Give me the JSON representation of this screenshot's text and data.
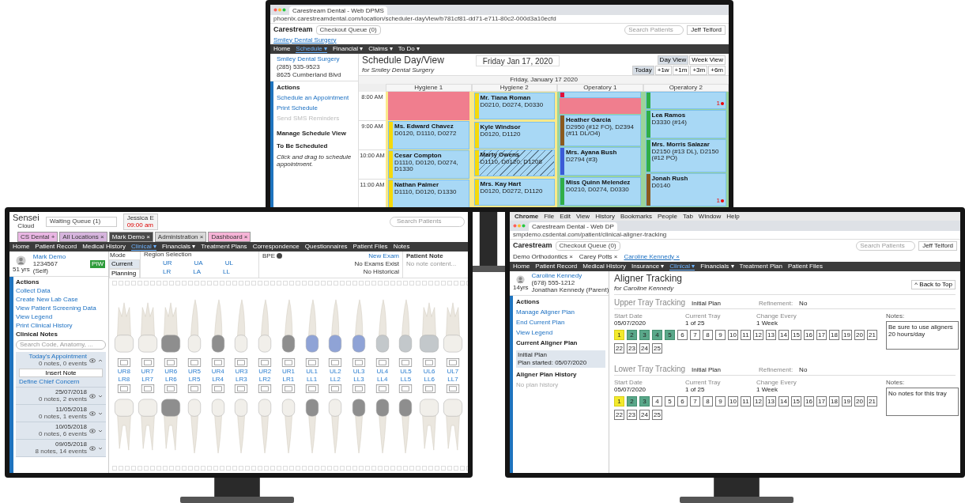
{
  "schedule_monitor": {
    "browser": {
      "tab_title": "Carestream Dental - Web DPMS",
      "url": "phoenix.carestreamdental.com/location/scheduler-dayView/b781cf81-dd71-e711-80c2-000d3a10ecfd"
    },
    "header": {
      "logo": "Carestream",
      "queue": "Checkout Queue (0)",
      "search_placeholder": "Search Patients",
      "user": "Jeff Telford"
    },
    "location_tab": "Smiley Dental Surgery",
    "nav": [
      {
        "label": "Home",
        "selected": false
      },
      {
        "label": "Schedule ▾",
        "selected": true
      },
      {
        "label": "Financial ▾",
        "selected": false
      },
      {
        "label": "Claims ▾",
        "selected": false
      },
      {
        "label": "To Do ▾",
        "selected": false
      }
    ],
    "sidebar": {
      "practice": "Smiley Dental Surgery",
      "phone": "(285) 535-9523",
      "address": "8625 Cumberland Blvd",
      "actions_title": "Actions",
      "actions": [
        {
          "label": "Schedule an Appointment",
          "disabled": false
        },
        {
          "label": "Print Schedule",
          "disabled": false
        },
        {
          "label": "Send SMS Reminders",
          "disabled": true
        }
      ],
      "manage": "Manage Schedule View",
      "to_schedule": "To Be Scheduled",
      "hint": "Click and drag to schedule appointment."
    },
    "title": "Schedule Day/View",
    "subtitle": "for Smiley Dental Surgery",
    "date": "Friday Jan 17, 2020",
    "views": [
      {
        "label": "Day View",
        "selected": true
      },
      {
        "label": "Week View",
        "selected": false
      }
    ],
    "jumps": [
      {
        "label": "Today",
        "selected": true
      },
      {
        "label": "+1w",
        "selected": false
      },
      {
        "label": "+1m",
        "selected": false
      },
      {
        "label": "+3m",
        "selected": false
      },
      {
        "label": "+6m",
        "selected": false
      }
    ],
    "day_header": "Friday, January 17 2020",
    "times": [
      "8:00 AM",
      "9:00 AM",
      "10:00 AM",
      "11:00 AM"
    ],
    "columns": [
      {
        "name": "Hygiene 1",
        "color": "#fbe98a",
        "items": [
          {
            "kind": "blocked"
          },
          {
            "kind": "appointment",
            "name": "Ms. Edward Chavez",
            "codes": "D0120, D1110, D0272",
            "color": "#f5d90a",
            "hatched": false
          },
          {
            "kind": "appointment",
            "name": "Cesar Compton",
            "codes": "D1110, D0120, D0274, D1330",
            "color": "#f5d90a",
            "hatched": false
          },
          {
            "kind": "appointment",
            "name": "Nathan Palmer",
            "codes": "D1110, D0120, D1330",
            "color": "#f5d90a",
            "hatched": false
          }
        ]
      },
      {
        "name": "Hygiene 2",
        "color": "#fbe98a",
        "items": [
          {
            "kind": "appointment",
            "name": "Mr. Tiana Roman",
            "codes": "D0210, D0274, D0330",
            "color": "#f5d90a",
            "hatched": false
          },
          {
            "kind": "appointment",
            "name": "Kyle Windsor",
            "codes": "D0120, D1120",
            "color": "#f5d90a",
            "hatched": false
          },
          {
            "kind": "appointment",
            "name": "Marty Owens",
            "codes": "D1110, D0120, D1208",
            "color": "#f5d90a",
            "hatched": true
          },
          {
            "kind": "appointment",
            "name": "Mrs. Kay Hart",
            "codes": "D0120, D0272, D1120",
            "color": "#f5d90a",
            "hatched": false
          }
        ]
      },
      {
        "name": "Operatory 1",
        "color": "#9bd49a",
        "items": [
          {
            "kind": "appointment",
            "color": "#e0103a",
            "hatched": false
          },
          {
            "kind": "blocked"
          },
          {
            "kind": "appointment",
            "name": "Heather Garcia",
            "codes": "D2950 (#12 FO), D2394 (#11 DL/O4)",
            "color": "#8b5a1e",
            "hatched": false
          },
          {
            "kind": "appointment",
            "name": "Mrs. Ayana Bush",
            "codes": "D2794 (#3)",
            "color": "#3b5bd6",
            "hatched": false
          },
          {
            "kind": "appointment",
            "name": "Miss Quinn Melendez",
            "codes": "D0210, D0274, D0330",
            "color": "#2fae48",
            "hatched": false
          }
        ]
      },
      {
        "name": "Operatory 2",
        "color": "#9bd49a",
        "items": [
          {
            "kind": "appointment",
            "color": "#2fae48",
            "hatched": false,
            "flag": "1"
          },
          {
            "kind": "appointment",
            "name": "Lea Ramos",
            "codes": "D3330 (#14)",
            "color": "#2fae48",
            "hatched": false
          },
          {
            "kind": "appointment",
            "name": "Mrs. Morris Salazar",
            "codes": "D2150 (#13 DL), D2150 (#12 PO)",
            "color": "#2fae48",
            "hatched": false
          },
          {
            "kind": "appointment",
            "name": "Jonah Rush",
            "codes": "D0140",
            "color": "#8b5a1e",
            "hatched": false,
            "flag": "1"
          }
        ]
      }
    ]
  },
  "clinical_monitor": {
    "header": {
      "logo": "Sensei",
      "logo_sub": "Cloud",
      "queue": "Waiting Queue (1)",
      "user": "Jessica E",
      "time": "09:00 am",
      "search_placeholder": "Search Patients"
    },
    "tabs": [
      {
        "label": "CS Dental",
        "close": "+",
        "color": "#e9b6e3",
        "selected": false
      },
      {
        "label": "All Locations",
        "close": "×",
        "color": "#d6b4dd",
        "selected": false
      },
      {
        "label": "Mark Demo",
        "close": "×",
        "color": "#4a4a4a",
        "selected": true
      },
      {
        "label": "Administration",
        "close": "×",
        "color": "#d9d9d9",
        "selected": false
      },
      {
        "label": "Dashboard",
        "close": "×",
        "color": "#f6b3d6",
        "selected": false
      }
    ],
    "nav": [
      {
        "label": "Home",
        "selected": false
      },
      {
        "label": "Patient Record",
        "selected": false
      },
      {
        "label": "Medical History",
        "selected": false
      },
      {
        "label": "Clinical ▾",
        "selected": true
      },
      {
        "label": "Financials ▾",
        "selected": false
      },
      {
        "label": "Treatment Plans",
        "selected": false
      },
      {
        "label": "Correspondence",
        "selected": false
      },
      {
        "label": "Questionnaires",
        "selected": false
      },
      {
        "label": "Patient Files",
        "selected": false
      },
      {
        "label": "Notes",
        "selected": false
      }
    ],
    "patient": {
      "name": "Mark Demo",
      "id": "1234567",
      "age": "51 yrs",
      "relation": "(Self)",
      "badge": "PIW"
    },
    "mode": {
      "label": "Mode",
      "options": [
        {
          "label": "Current",
          "selected": true
        },
        {
          "label": "Planning",
          "selected": false
        }
      ]
    },
    "region": {
      "label": "Region Selection",
      "upper": [
        "UR",
        "UA",
        "UL"
      ],
      "lower": [
        "LR",
        "LA",
        "LL"
      ]
    },
    "bpe": "BPE",
    "exam": {
      "link": "New Exam",
      "status": "No Exams Exist",
      "history": "No Historical"
    },
    "patient_note": {
      "title": "Patient Note",
      "text": "No note content..."
    },
    "actions_title": "Actions",
    "actions": [
      "Collect Data",
      "Create New Lab Case",
      "View Patient Screening Data",
      "View Legend",
      "Print Clinical History"
    ],
    "notes_title": "Clinical Notes",
    "notes_search_placeholder": "Search Code, Anatomy, ...",
    "insert_note": "Insert Note",
    "chief_concern": "Define Chief Concern",
    "appointments": [
      {
        "title": "Today's Appointment",
        "summary": "0 notes, 0 events",
        "expanded": true
      },
      {
        "title": "25/07/2018",
        "summary": "0 notes, 2 events",
        "expanded": false
      },
      {
        "title": "11/05/2018",
        "summary": "0 notes, 1 events",
        "expanded": false
      },
      {
        "title": "10/05/2018",
        "summary": "0 notes, 6 events",
        "expanded": false
      },
      {
        "title": "09/05/2018",
        "summary": "8 notes, 14 events",
        "expanded": false
      }
    ],
    "upper_teeth": [
      {
        "label": "UR8",
        "color": "#f1efea"
      },
      {
        "label": "UR7",
        "color": "#f1efea"
      },
      {
        "label": "UR6",
        "color": "#8e8e8e"
      },
      {
        "label": "UR5",
        "color": "#f1efea"
      },
      {
        "label": "UR4",
        "color": "#8e8e8e"
      },
      {
        "label": "UR3",
        "color": "#f1efea"
      },
      {
        "label": "UR2",
        "color": "#f1efea"
      },
      {
        "label": "UR1",
        "color": "#8e8e8e"
      },
      {
        "label": "UL1",
        "color": "#8fa3d6"
      },
      {
        "label": "UL2",
        "color": "#8fa3d6"
      },
      {
        "label": "UL3",
        "color": "#8fa3d6"
      },
      {
        "label": "UL4",
        "color": "#c3c8cb"
      },
      {
        "label": "UL5",
        "color": "#c3c8cb"
      },
      {
        "label": "UL6",
        "color": "#c3c8cb"
      },
      {
        "label": "UL7",
        "color": "#f1efea"
      }
    ],
    "lower_teeth": [
      {
        "label": "LR8",
        "color": "#f1efea"
      },
      {
        "label": "LR7",
        "color": "#f1efea"
      },
      {
        "label": "LR6",
        "color": "#8e8e8e"
      },
      {
        "label": "LR5",
        "color": "#f1efea"
      },
      {
        "label": "LR4",
        "color": "#f1efea"
      },
      {
        "label": "LR3",
        "color": "#f1efea"
      },
      {
        "label": "LR2",
        "color": "#f1efea"
      },
      {
        "label": "LR1",
        "color": "#f1efea"
      },
      {
        "label": "LL1",
        "color": "#8e8e8e"
      },
      {
        "label": "LL2",
        "color": "#f1efea"
      },
      {
        "label": "LL3",
        "color": "#8e8e8e"
      },
      {
        "label": "LL4",
        "color": "#8e8e8e"
      },
      {
        "label": "LL5",
        "color": "#8e8e8e"
      },
      {
        "label": "LL6",
        "color": "#f1efea"
      },
      {
        "label": "LL7",
        "color": "#f1efea"
      }
    ]
  },
  "aligner_monitor": {
    "menu_bar": [
      "Chrome",
      "File",
      "Edit",
      "View",
      "History",
      "Bookmarks",
      "People",
      "Tab",
      "Window",
      "Help"
    ],
    "browser": {
      "tab_title": "Carestream Dental - Web DP",
      "url": "smpdemo.csdental.com/patient/clinical-aligner-tracking"
    },
    "header": {
      "logo": "Carestream",
      "queue": "Checkout Queue (0)",
      "search_placeholder": "Search Patients",
      "user": "Jeff Telford"
    },
    "patient_tabs": [
      {
        "label": "Demo Orthodontics",
        "close": "×",
        "selected": false
      },
      {
        "label": "Carey Potts",
        "close": "×",
        "selected": false
      },
      {
        "label": "Caroline Kennedy",
        "close": "×",
        "selected": true
      }
    ],
    "nav": [
      {
        "label": "Home",
        "selected": false
      },
      {
        "label": "Patient Record",
        "selected": false
      },
      {
        "label": "Medical History",
        "selected": false
      },
      {
        "label": "Insurance ▾",
        "selected": false
      },
      {
        "label": "Clinical ▾",
        "selected": true
      },
      {
        "label": "Financials ▾",
        "selected": false
      },
      {
        "label": "Treatment Plan",
        "selected": false
      },
      {
        "label": "Patient Files",
        "selected": false
      }
    ],
    "patient": {
      "name": "Caroline Kennedy",
      "phone": "(678) 555-1212",
      "age": "14yrs",
      "guardian": "Jonathan Kennedy (Parent)"
    },
    "actions_title": "Actions",
    "actions": [
      "Manage Aligner Plan",
      "End Current Plan",
      "View Legend"
    ],
    "current_plan_title": "Current Aligner Plan",
    "current_plan": "Initial Plan",
    "plan_started": "Plan started: 05/07/2020",
    "history_title": "Aligner Plan History",
    "history": "No plan history",
    "title": "Aligner Tracking",
    "subtitle": "for Caroline Kennedy",
    "back_to_top": "^ Back to Top",
    "trays": [
      {
        "title": "Upper Tray Tracking",
        "plan": "Initial Plan",
        "refinement_label": "Refinement:",
        "refinement": "No",
        "start_label": "Start Date",
        "start": "05/07/2020",
        "current_label": "Current Tray",
        "current": "1 of 25",
        "change_label": "Change Every",
        "change": "1 Week",
        "notes_label": "Notes:",
        "notes": "Be sure to use aligners 20 hours/day",
        "items": [
          {
            "label": "1",
            "kind": "current"
          },
          {
            "label": "2",
            "kind": "done"
          },
          {
            "label": "3",
            "kind": "done"
          },
          {
            "label": "4",
            "kind": "done"
          },
          {
            "label": "5",
            "kind": "done"
          },
          {
            "label": "6",
            "kind": "pending"
          },
          {
            "label": "7",
            "kind": "pending"
          },
          {
            "label": "8",
            "kind": "pending"
          },
          {
            "label": "9",
            "kind": "pending"
          },
          {
            "label": "10",
            "kind": "pending"
          },
          {
            "label": "11",
            "kind": "pending"
          },
          {
            "label": "12",
            "kind": "pending"
          },
          {
            "label": "13",
            "kind": "pending"
          },
          {
            "label": "14",
            "kind": "pending"
          },
          {
            "label": "15",
            "kind": "pending"
          },
          {
            "label": "16",
            "kind": "pending"
          },
          {
            "label": "17",
            "kind": "pending"
          },
          {
            "label": "18",
            "kind": "pending"
          },
          {
            "label": "19",
            "kind": "pending"
          },
          {
            "label": "20",
            "kind": "pending"
          },
          {
            "label": "21",
            "kind": "pending"
          },
          {
            "label": "22",
            "kind": "pending"
          },
          {
            "label": "23",
            "kind": "pending"
          },
          {
            "label": "24",
            "kind": "pending"
          },
          {
            "label": "25",
            "kind": "pending"
          }
        ]
      },
      {
        "title": "Lower Tray Tracking",
        "plan": "Initial Plan",
        "refinement_label": "Refinement:",
        "refinement": "No",
        "start_label": "Start Date",
        "start": "05/07/2020",
        "current_label": "Current Tray",
        "current": "1 of 25",
        "change_label": "Change Every",
        "change": "1 Week",
        "notes_label": "Notes:",
        "notes": "No notes for this tray",
        "items": [
          {
            "label": "1",
            "kind": "current"
          },
          {
            "label": "2",
            "kind": "done"
          },
          {
            "label": "3",
            "kind": "done"
          },
          {
            "label": "4",
            "kind": "pending"
          },
          {
            "label": "5",
            "kind": "pending"
          },
          {
            "label": "6",
            "kind": "pending"
          },
          {
            "label": "7",
            "kind": "pending"
          },
          {
            "label": "8",
            "kind": "pending"
          },
          {
            "label": "9",
            "kind": "pending"
          },
          {
            "label": "10",
            "kind": "pending"
          },
          {
            "label": "11",
            "kind": "pending"
          },
          {
            "label": "12",
            "kind": "pending"
          },
          {
            "label": "13",
            "kind": "pending"
          },
          {
            "label": "14",
            "kind": "pending"
          },
          {
            "label": "15",
            "kind": "pending"
          },
          {
            "label": "16",
            "kind": "pending"
          },
          {
            "label": "17",
            "kind": "pending"
          },
          {
            "label": "18",
            "kind": "pending"
          },
          {
            "label": "19",
            "kind": "pending"
          },
          {
            "label": "20",
            "kind": "pending"
          },
          {
            "label": "21",
            "kind": "pending"
          },
          {
            "label": "22",
            "kind": "pending"
          },
          {
            "label": "23",
            "kind": "pending"
          },
          {
            "label": "24",
            "kind": "pending"
          },
          {
            "label": "25",
            "kind": "pending"
          }
        ]
      }
    ]
  }
}
